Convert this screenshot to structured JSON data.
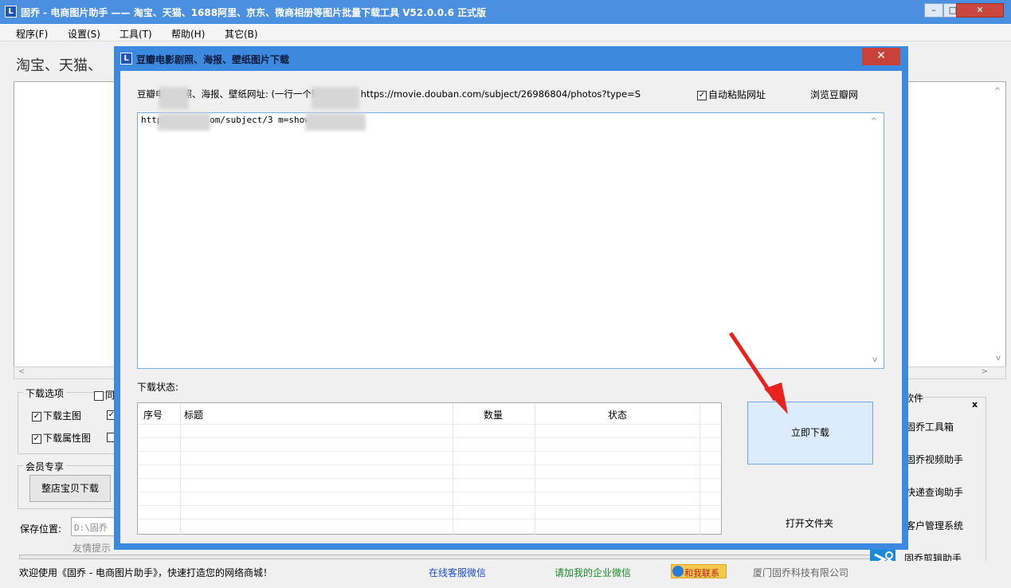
{
  "window": {
    "title": "固乔 - 电商图片助手 —— 淘宝、天猫、1688阿里、京东、微商相册等图片批量下载工具 V52.0.0.6 正式版",
    "icon_label": "L",
    "minimize": "–",
    "maximize": "□",
    "close": "✕"
  },
  "menu": [
    "程序(F)",
    "设置(S)",
    "工具(T)",
    "帮助(H)",
    "其它(B)"
  ],
  "main": {
    "heading": "淘宝、天猫、",
    "download_options_label": "下载选项",
    "opt_main_image": "下载主图",
    "opt_attr_image": "下载属性图",
    "opt_partial": "同",
    "member_label": "会员专享",
    "shop_download_button": "整店宝贝下载",
    "save_location_label": "保存位置:",
    "save_path": "D:\\固乔",
    "tip_text": "友情提示",
    "scroll_up": "^",
    "scroll_down": "v",
    "scroll_left": "<",
    "scroll_right": ">"
  },
  "side": {
    "header": "软件",
    "close": "x",
    "items": [
      "固乔工具箱",
      "固乔视频助手",
      "快递查询助手",
      "客户管理系统",
      "固乔剪辑助手"
    ]
  },
  "statusbar": {
    "welcome": "欢迎使用《固乔 - 电商图片助手》，快速打造您的网络商城！",
    "support_link": "在线客服微信",
    "wechat_link": "请加我的企业微信",
    "contact_badge": "和我联系",
    "company": "厦门固乔科技有限公司"
  },
  "dialog": {
    "title": "豆瓣电影剧照、海报、壁纸图片下载",
    "close": "✕",
    "url_label": "豆瓣电影剧照、海报、壁纸网址: (一行一个链接) 示例: https://movie.douban.com/subject/26986804/photos?type=S",
    "auto_paste_label": "自动粘贴网址",
    "auto_paste_checked": "✓",
    "browse_link": "浏览豆瓣网",
    "url_value": "http          douban.com/subject/3              m=showing",
    "status_label": "下载状态:",
    "columns": [
      "序号",
      "标题",
      "数量",
      "状态"
    ],
    "download_button": "立即下载",
    "open_folder": "打开文件夹"
  }
}
